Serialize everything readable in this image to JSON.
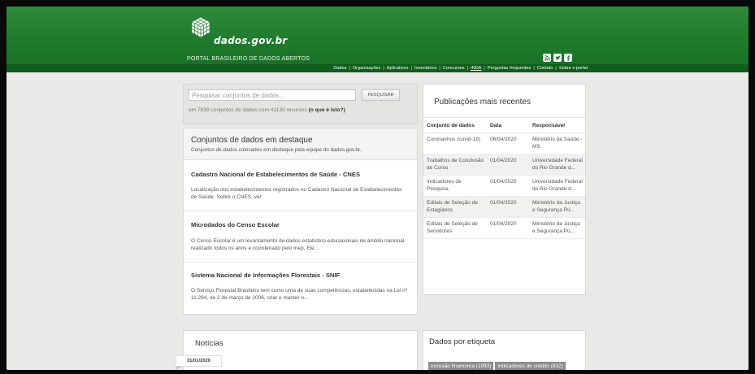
{
  "header": {
    "site_name": "dados.gov.br",
    "tagline": "PORTAL BRASILEIRO DE DADOS ABERTOS",
    "social_icons": [
      "rss-icon",
      "twitter-icon",
      "facebook-icon"
    ],
    "nav": [
      "Dados",
      "Organizações",
      "Aplicativos",
      "Inventários",
      "Concursos",
      "INDA",
      "Perguntas frequentes",
      "Contato",
      "Sobre o portal"
    ]
  },
  "search": {
    "placeholder": "Pesquisar conjuntos de dados...",
    "button_label": "PESQUISAR",
    "stats_text": "em 7839 conjuntos de dados com 41130 recursos",
    "help_link": "(o que é isto?)"
  },
  "featured": {
    "title": "Conjuntos de dados em destaque",
    "subtitle": "Conjuntos de dados colocados em destaque pela equipe do dados.gov.br.",
    "items": [
      {
        "title": "Cadastro Nacional de Estabelecimentos de Saúde - CNES",
        "description": "Localização dos estabelecimentos registrados no Cadastro Nacional de Estabelecimentos de Saúde. Sobre o CNES, ver:"
      },
      {
        "title": "Microdados do Censo Escolar",
        "description": "O Censo Escolar é um levantamento de dados estatístico-educacionais de âmbito nacional realizado todos os anos e coordenado pelo Inep. Ele..."
      },
      {
        "title": "Sistema Nacional de Informações Florestais - SNIF",
        "description": "O Serviço Florestal Brasileiro tem como uma de suas competências, estabelecidas na Lei nº 11.284, de 2 de março de 2006, criar e manter o..."
      }
    ]
  },
  "publications": {
    "title": "Publicações mais recentes",
    "columns": [
      "Conjunto de dados",
      "Data",
      "Responsável"
    ],
    "rows": [
      {
        "dataset": "Coronavírus (covid-19)",
        "date": "06/04/2020",
        "owner": "Ministério da Saúde - MS"
      },
      {
        "dataset": "Trabalhos de Conclusão de Curso",
        "date": "01/04/2020",
        "owner": "Universidade Federal do Rio Grande d..."
      },
      {
        "dataset": "Indicadores de Pesquisa",
        "date": "01/04/2020",
        "owner": "Universidade Federal do Rio Grande d..."
      },
      {
        "dataset": "Editais de Seleção de Estagiários",
        "date": "01/04/2020",
        "owner": "Ministério da Justiça e Segurança Pú..."
      },
      {
        "dataset": "Editais de Seleção de Servidores",
        "date": "01/04/2020",
        "owner": "Ministério da Justiça e Segurança Pú..."
      }
    ]
  },
  "news": {
    "title": "Notícias",
    "date": "31/01/2020"
  },
  "tags": {
    "title": "Dados por etiqueta",
    "items": [
      "inclusão financeira (1993)",
      "indicadores de crédito (832)"
    ]
  },
  "colors": {
    "header_green": "#1e7a2c",
    "nav_green": "#0f5e1b",
    "tag_gray": "#8c8c8c"
  }
}
